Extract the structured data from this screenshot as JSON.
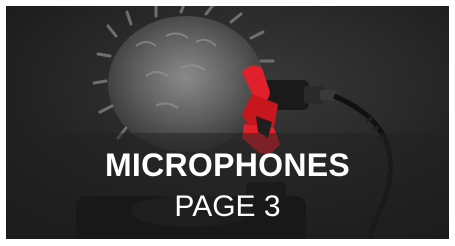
{
  "card": {
    "title": "MICROPHONES",
    "subtitle": "PAGE 3",
    "image": {
      "icon": "microphone-photo",
      "background_color": "#1e1e1e",
      "accent_color": "#e0202a"
    }
  }
}
